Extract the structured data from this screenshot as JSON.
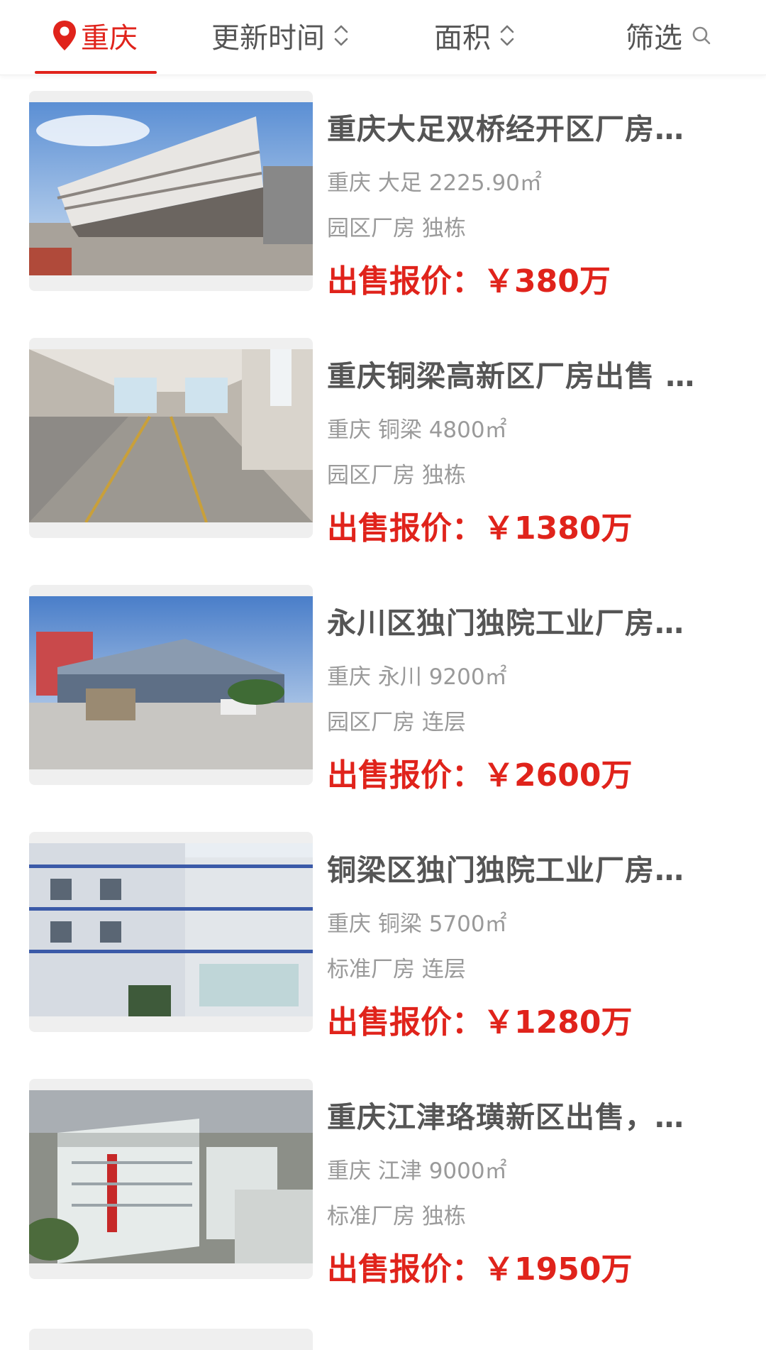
{
  "tabs": {
    "city": "重庆",
    "update_time": "更新时间",
    "area": "面积",
    "filter": "筛选"
  },
  "colors": {
    "accent": "#e0231b",
    "text": "#555555",
    "muted": "#9a9a9a"
  },
  "listings": [
    {
      "title": "重庆大足双桥经开区厂房…",
      "meta": "重庆 大足 2225.90㎡",
      "tags": "园区厂房 独栋",
      "price": "出售报价：￥380万"
    },
    {
      "title": "重庆铜梁高新区厂房出售 …",
      "meta": "重庆 铜梁 4800㎡",
      "tags": "园区厂房 独栋",
      "price": "出售报价：￥1380万"
    },
    {
      "title": "永川区独门独院工业厂房…",
      "meta": "重庆 永川 9200㎡",
      "tags": "园区厂房 连层",
      "price": "出售报价：￥2600万"
    },
    {
      "title": "铜梁区独门独院工业厂房…",
      "meta": "重庆 铜梁 5700㎡",
      "tags": "标准厂房 连层",
      "price": "出售报价：￥1280万"
    },
    {
      "title": "重庆江津珞璜新区出售，…",
      "meta": "重庆 江津 9000㎡",
      "tags": "标准厂房 独栋",
      "price": "出售报价：￥1950万"
    }
  ]
}
